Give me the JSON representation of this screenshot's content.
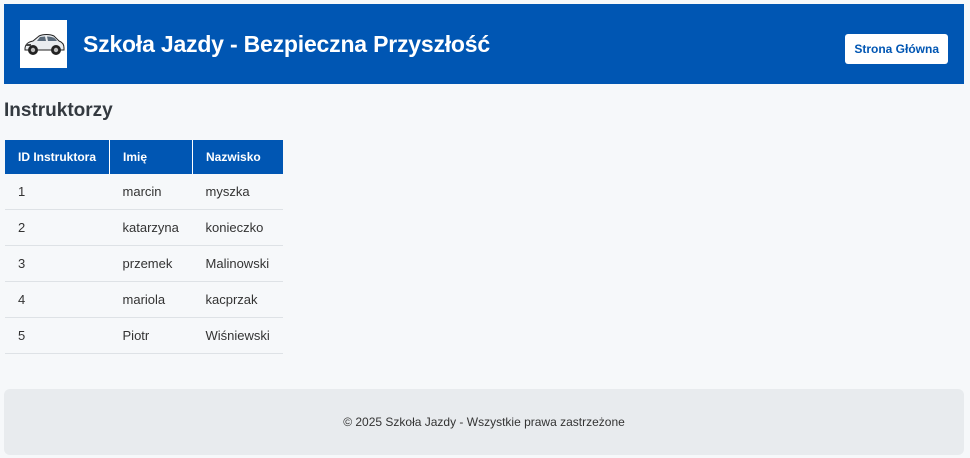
{
  "header": {
    "logo_icon": "car-logo-icon",
    "title": "Szkoła Jazdy - Bezpieczna Przyszłość",
    "home_button": "Strona Główna",
    "background_color": "#0056b3"
  },
  "main": {
    "heading": "Instruktorzy",
    "table": {
      "columns": [
        "ID Instruktora",
        "Imię",
        "Nazwisko"
      ],
      "rows": [
        {
          "id": "1",
          "first_name": "marcin",
          "last_name": "myszka"
        },
        {
          "id": "2",
          "first_name": "katarzyna",
          "last_name": "konieczko"
        },
        {
          "id": "3",
          "first_name": "przemek",
          "last_name": "Malinowski"
        },
        {
          "id": "4",
          "first_name": "mariola",
          "last_name": "kacprzak"
        },
        {
          "id": "5",
          "first_name": "Piotr",
          "last_name": "Wiśniewski"
        }
      ]
    }
  },
  "footer": {
    "text": "© 2025 Szkoła Jazdy - Wszystkie prawa zastrzeżone"
  }
}
